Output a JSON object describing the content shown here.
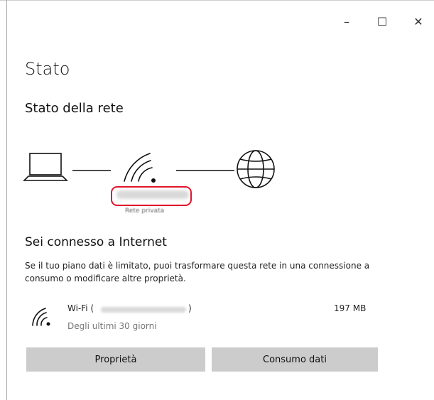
{
  "window": {
    "controls": {
      "minimize_glyph": "–",
      "maximize_glyph": "☐",
      "close_glyph": "✕"
    }
  },
  "page": {
    "title": "Stato",
    "section_title": "Stato della rete"
  },
  "network_diagram": {
    "icons": [
      "laptop-icon",
      "wifi-icon",
      "globe-icon"
    ],
    "network_type": "Rete privata"
  },
  "internet_status": {
    "title": "Sei connesso a Internet",
    "description": "Se il tuo piano dati è limitato, puoi trasformare questa rete in una connessione a consumo o modificare altre proprietà."
  },
  "connection": {
    "icon": "wifi-icon",
    "name_prefix": "Wi-Fi (",
    "name_suffix": ")",
    "period": "Degli ultimi 30 giorni",
    "usage": "197 MB"
  },
  "buttons": {
    "properties": "Proprietà",
    "data_usage": "Consumo dati"
  },
  "colors": {
    "highlight": "#e0152b",
    "button_bg": "#cccccc"
  }
}
